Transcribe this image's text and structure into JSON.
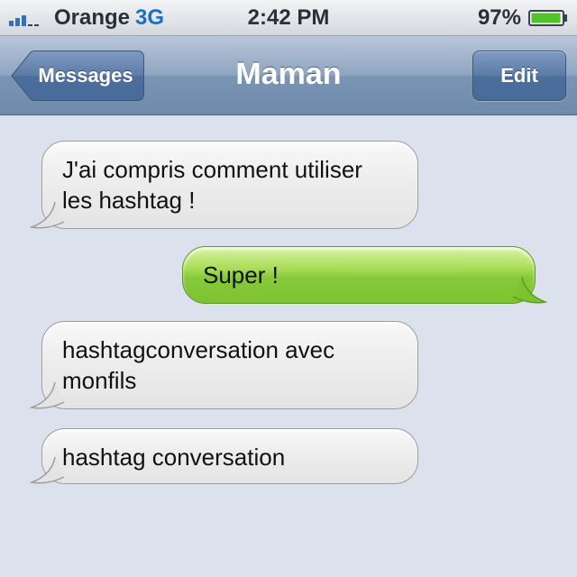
{
  "status_bar": {
    "carrier": "Orange",
    "network": "3G",
    "time": "2:42 PM",
    "battery_percent": "97%",
    "battery_level": 0.97,
    "signal_icon": "signal-bars-icon",
    "battery_icon": "battery-icon"
  },
  "nav": {
    "back_label": "Messages",
    "title": "Maman",
    "edit_label": "Edit"
  },
  "messages": [
    {
      "direction": "incoming",
      "lines": [
        "J'ai compris comment utiliser",
        "les hashtag !"
      ]
    },
    {
      "direction": "outgoing",
      "lines": [
        "Super !"
      ]
    },
    {
      "direction": "incoming",
      "lines": [
        "hashtagconversation avec",
        "monfils"
      ]
    },
    {
      "direction": "incoming",
      "lines": [
        "hashtag conversation"
      ]
    }
  ],
  "colors": {
    "background": "#dbe2ed",
    "incoming_bubble": "#ececec",
    "outgoing_bubble": "#8dcc3e",
    "nav_bar": "#8ea4c0",
    "network_text": "#1a6fc9",
    "battery_fill": "#52c42a"
  }
}
